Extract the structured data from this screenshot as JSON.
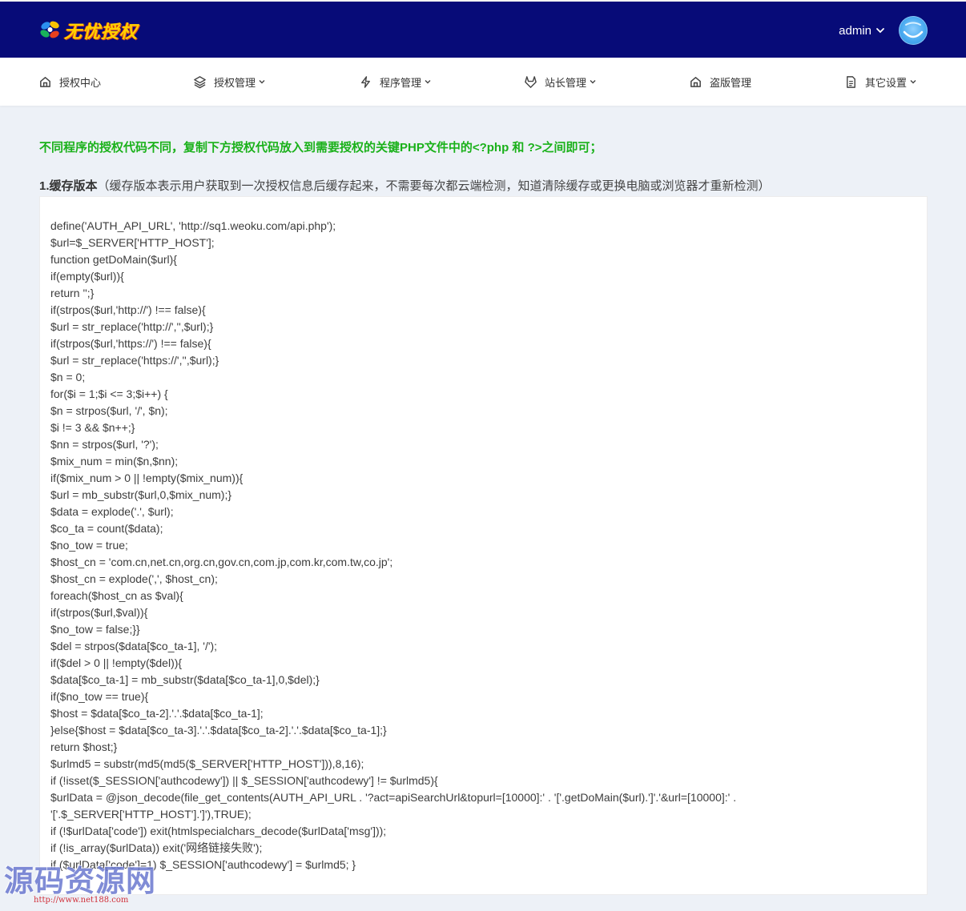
{
  "header": {
    "logo_text": "无忧授权",
    "user_name": "admin",
    "icons": {
      "logo": "flower-logo-icon",
      "caret": "chevron-down-icon",
      "avatar": "avatar"
    }
  },
  "nav": {
    "items": [
      {
        "label": "授权中心",
        "icon": "home-icon",
        "dropdown": false
      },
      {
        "label": "授权管理",
        "icon": "layers-icon",
        "dropdown": true
      },
      {
        "label": "程序管理",
        "icon": "lightning-icon",
        "dropdown": true
      },
      {
        "label": "站长管理",
        "icon": "gitlab-icon",
        "dropdown": true
      },
      {
        "label": "盗版管理",
        "icon": "home-icon",
        "dropdown": false
      },
      {
        "label": "其它设置",
        "icon": "document-icon",
        "dropdown": true
      }
    ]
  },
  "main": {
    "notice": "不同程序的授权代码不同，复制下方授权代码放入到需要授权的关键PHP文件中的<?php 和 ?>之间即可；",
    "section_title": "1.缓存版本",
    "section_desc": "（缓存版本表示用户获取到一次授权信息后缓存起来，不需要每次都云端检测，知道清除缓存或更换电脑或浏览器才重新检测）",
    "code": "define('AUTH_API_URL', 'http://sq1.weoku.com/api.php');\n$url=$_SERVER['HTTP_HOST'];\nfunction getDoMain($url){\nif(empty($url)){\nreturn '';}\nif(strpos($url,'http://') !== false){\n$url = str_replace('http://','',$url);}\nif(strpos($url,'https://') !== false){\n$url = str_replace('https://','',$url);}\n$n = 0;\nfor($i = 1;$i <= 3;$i++) {\n$n = strpos($url, '/', $n);\n$i != 3 && $n++;}\n$nn = strpos($url, '?');\n$mix_num = min($n,$nn);\nif($mix_num > 0 || !empty($mix_num)){\n$url = mb_substr($url,0,$mix_num);}\n$data = explode('.', $url);\n$co_ta = count($data);\n$no_tow = true;\n$host_cn = 'com.cn,net.cn,org.cn,gov.cn,com.jp,com.kr,com.tw,co.jp';\n$host_cn = explode(',', $host_cn);\nforeach($host_cn as $val){\nif(strpos($url,$val)){\n$no_tow = false;}}\n$del = strpos($data[$co_ta-1], '/');\nif($del > 0 || !empty($del)){\n$data[$co_ta-1] = mb_substr($data[$co_ta-1],0,$del);}\nif($no_tow == true){\n$host = $data[$co_ta-2].'.'.$data[$co_ta-1];\n}else{$host = $data[$co_ta-3].'.'.$data[$co_ta-2].'.'.$data[$co_ta-1];}\nreturn $host;}\n$urlmd5 = substr(md5(md5($_SERVER['HTTP_HOST'])),8,16);\nif (!isset($_SESSION['authcodewy']) || $_SESSION['authcodewy'] != $urlmd5){\n$urlData = @json_decode(file_get_contents(AUTH_API_URL . '?act=apiSearchUrl&topurl=[10000]:' . '['.getDoMain($url).']'.'&url=[10000]:' .\n'['.$_SERVER['HTTP_HOST'].']'),TRUE);\nif (!$urlData['code']) exit(htmlspecialchars_decode($urlData['msg']));\nif (!is_array($urlData)) exit('网络链接失败');\nif ($urlData['code']=1) $_SESSION['authcodewy'] = $urlmd5; }"
  },
  "watermark": {
    "text": "源码资源网",
    "url": "http://www.net188.com"
  },
  "colors": {
    "header_bg": "#070b78",
    "notice_green": "#1ab11a",
    "page_bg": "#edf1f7"
  }
}
